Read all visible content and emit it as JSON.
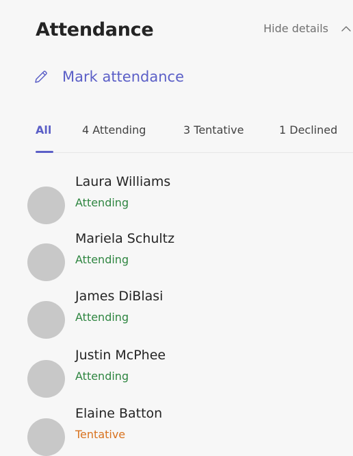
{
  "header": {
    "title": "Attendance",
    "hide_details_label": "Hide details"
  },
  "actions": {
    "mark_attendance_label": "Mark attendance"
  },
  "tabs": [
    {
      "label": "All",
      "active": true
    },
    {
      "label": "4 Attending",
      "active": false
    },
    {
      "label": "3 Tentative",
      "active": false
    },
    {
      "label": "1 Declined",
      "active": false
    }
  ],
  "colors": {
    "accent": "#5b5fc7",
    "attending": "#2e8540",
    "tentative": "#d8721e",
    "avatar": "#c8c8c8"
  },
  "people": [
    {
      "name": "Laura Williams",
      "status": "Attending",
      "status_type": "attending"
    },
    {
      "name": "Mariela Schultz",
      "status": "Attending",
      "status_type": "attending"
    },
    {
      "name": "James DiBlasi",
      "status": "Attending",
      "status_type": "attending"
    },
    {
      "name": "Justin McPhee",
      "status": "Attending",
      "status_type": "attending"
    },
    {
      "name": "Elaine Batton",
      "status": "Tentative",
      "status_type": "tentative"
    }
  ]
}
